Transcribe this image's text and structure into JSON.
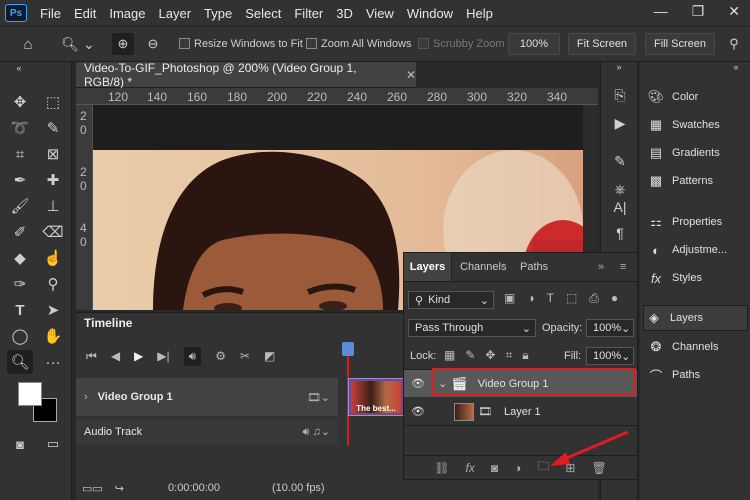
{
  "menubar": {
    "items": [
      "File",
      "Edit",
      "Image",
      "Layer",
      "Type",
      "Select",
      "Filter",
      "3D",
      "View",
      "Window",
      "Help"
    ],
    "logo": "Ps"
  },
  "options": {
    "resize_windows": "Resize Windows to Fit",
    "zoom_all": "Zoom All Windows",
    "scrubby": "Scrubby Zoom",
    "zoom_value": "100%",
    "fit_screen": "Fit Screen",
    "fill_screen": "Fill Screen"
  },
  "document": {
    "tab_title": "Video-To-GIF_Photoshop @ 200% (Video Group 1, RGB/8) *",
    "ruler_h": [
      "120",
      "140",
      "160",
      "180",
      "200",
      "220",
      "240",
      "260",
      "280",
      "300",
      "320",
      "340"
    ],
    "ruler_v": [
      "2",
      "0",
      "2",
      "0",
      "4",
      "0"
    ]
  },
  "right_panel": {
    "items": [
      "Color",
      "Swatches",
      "Gradients",
      "Patterns",
      "Properties",
      "Adjustme...",
      "Styles",
      "Layers",
      "Channels",
      "Paths"
    ],
    "active": "Layers"
  },
  "timeline": {
    "title": "Timeline",
    "track_name": "Video Group 1",
    "audio_track": "Audio Track",
    "clip_label": "The best...",
    "timecode": "0:00:00:00",
    "fps": "(10.00 fps)"
  },
  "layers_panel": {
    "tabs": [
      "Layers",
      "Channels",
      "Paths"
    ],
    "filter_kind": "Kind",
    "blend_mode": "Pass Through",
    "opacity_label": "Opacity:",
    "opacity_value": "100%",
    "lock_label": "Lock:",
    "fill_label": "Fill:",
    "fill_value": "100%",
    "group_name": "Video Group 1",
    "layer_name": "Layer 1"
  },
  "colors": {
    "accent_red": "#e21b22",
    "ps_blue": "#31a8ff"
  }
}
